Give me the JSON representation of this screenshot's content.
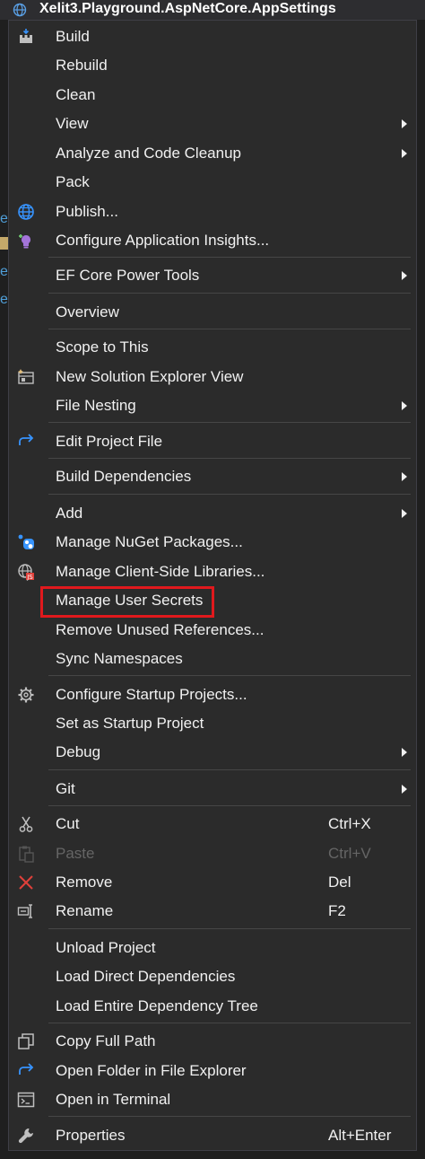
{
  "header": {
    "title": "Xelit3.Playground.AspNetCore.AppSettings",
    "icon": "globe-project-icon"
  },
  "editor_fragments": [
    "e",
    "e",
    "e",
    "e"
  ],
  "menu": {
    "items": [
      {
        "label": "Build",
        "icon": "build-icon"
      },
      {
        "label": "Rebuild"
      },
      {
        "label": "Clean"
      },
      {
        "label": "View",
        "submenu": true
      },
      {
        "label": "Analyze and Code Cleanup",
        "submenu": true
      },
      {
        "label": "Pack"
      },
      {
        "label": "Publish...",
        "icon": "globe-publish-icon"
      },
      {
        "label": "Configure Application Insights...",
        "icon": "insights-icon"
      },
      {
        "label": "EF Core Power Tools",
        "submenu": true
      },
      {
        "label": "Overview"
      },
      {
        "label": "Scope to This"
      },
      {
        "label": "New Solution Explorer View",
        "icon": "new-explorer-view-icon"
      },
      {
        "label": "File Nesting",
        "submenu": true
      },
      {
        "label": "Edit Project File",
        "icon": "edit-project-arrow-icon"
      },
      {
        "label": "Build Dependencies",
        "submenu": true
      },
      {
        "label": "Add",
        "submenu": true
      },
      {
        "label": "Manage NuGet Packages...",
        "icon": "nuget-icon"
      },
      {
        "label": "Manage Client-Side Libraries...",
        "icon": "client-libraries-icon"
      },
      {
        "label": "Manage User Secrets",
        "highlighted": true
      },
      {
        "label": "Remove Unused References..."
      },
      {
        "label": "Sync Namespaces"
      },
      {
        "label": "Configure Startup Projects...",
        "icon": "gear-icon"
      },
      {
        "label": "Set as Startup Project"
      },
      {
        "label": "Debug",
        "submenu": true
      },
      {
        "label": "Git",
        "submenu": true
      },
      {
        "label": "Cut",
        "shortcut": "Ctrl+X",
        "icon": "scissors-icon"
      },
      {
        "label": "Paste",
        "shortcut": "Ctrl+V",
        "icon": "clipboard-icon",
        "disabled": true
      },
      {
        "label": "Remove",
        "shortcut": "Del",
        "icon": "remove-x-icon"
      },
      {
        "label": "Rename",
        "shortcut": "F2",
        "icon": "rename-icon"
      },
      {
        "label": "Unload Project"
      },
      {
        "label": "Load Direct Dependencies"
      },
      {
        "label": "Load Entire Dependency Tree"
      },
      {
        "label": "Copy Full Path",
        "icon": "copy-icon"
      },
      {
        "label": "Open Folder in File Explorer",
        "icon": "open-folder-arrow-icon"
      },
      {
        "label": "Open in Terminal",
        "icon": "terminal-icon"
      },
      {
        "label": "Properties",
        "shortcut": "Alt+Enter",
        "icon": "wrench-icon"
      }
    ]
  },
  "colors": {
    "menu_bg": "#2b2b2b",
    "text": "#f1f1f1",
    "disabled_text": "#656565",
    "highlight_border": "#e0191d",
    "icon_blue": "#3794ff",
    "icon_red": "#e0403a"
  }
}
